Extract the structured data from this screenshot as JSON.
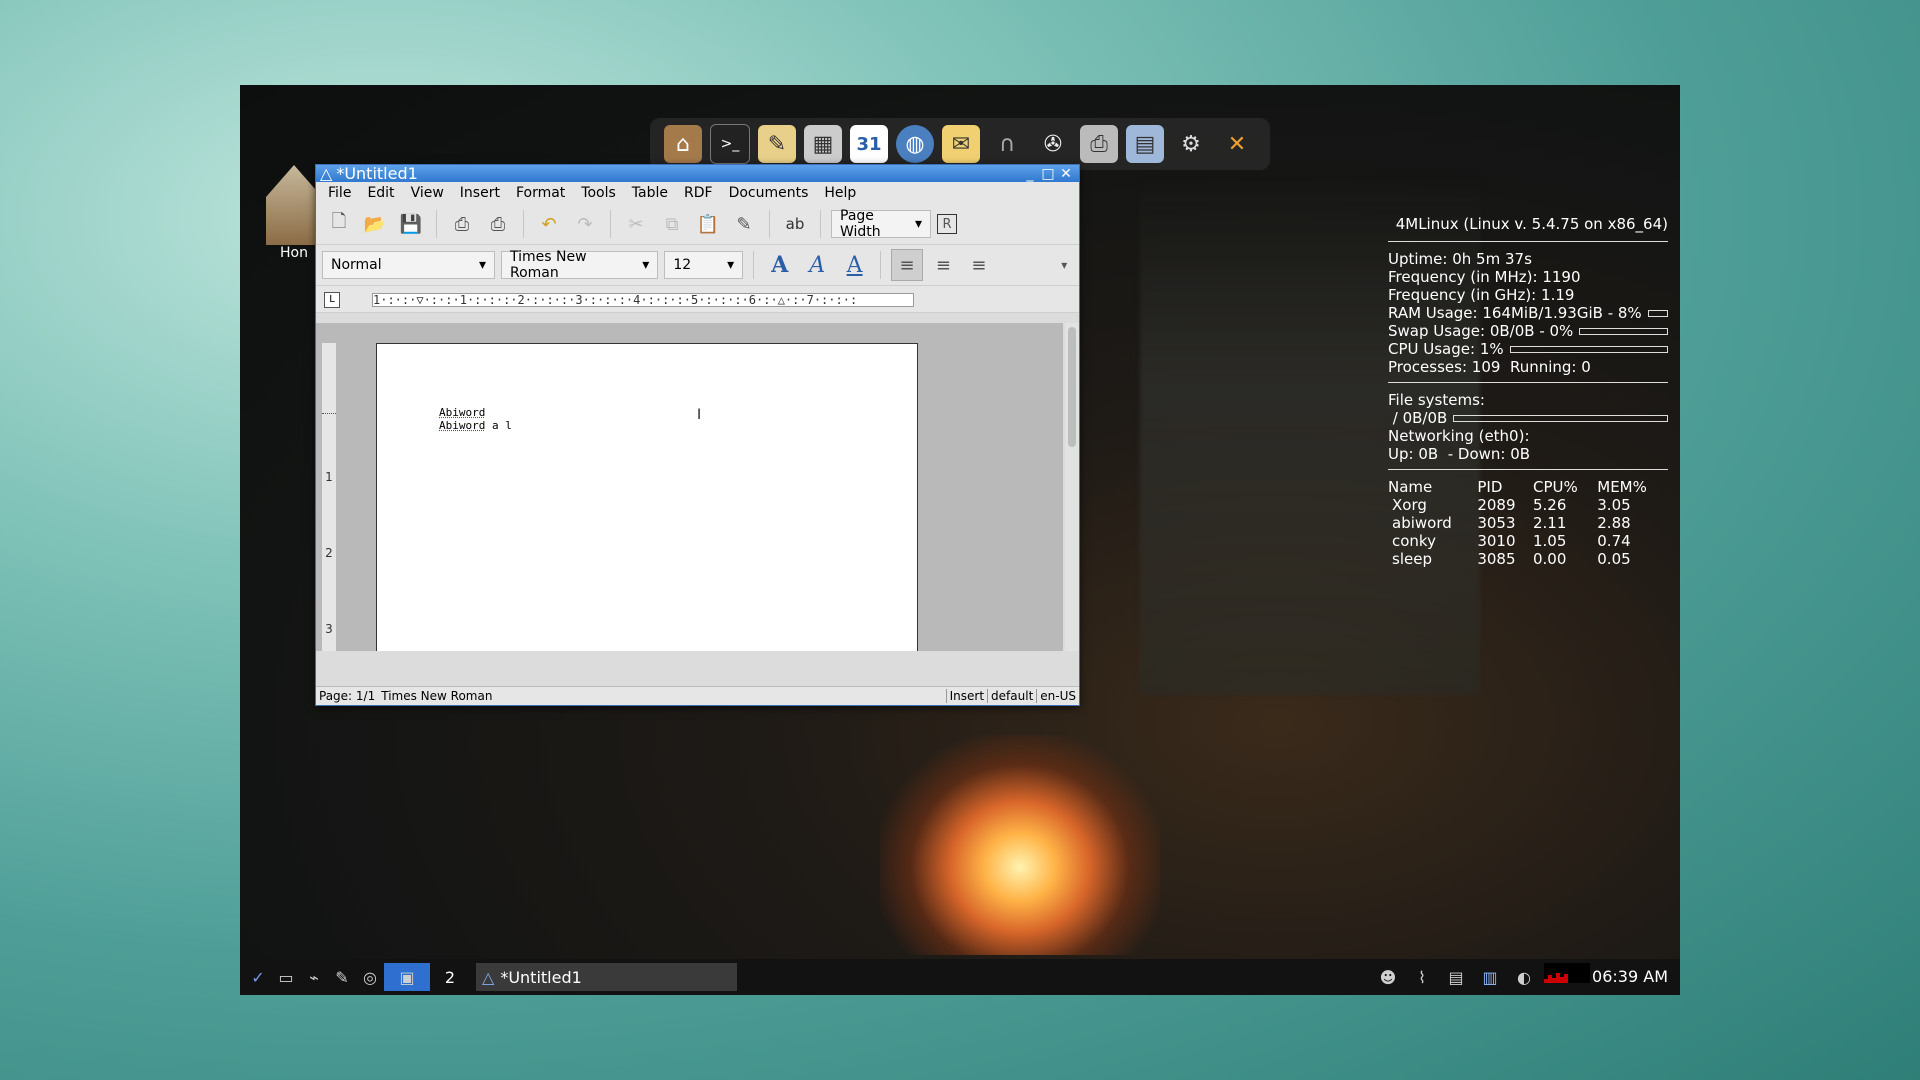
{
  "desktop": {
    "home_label": "Hon",
    "dock_icons": [
      "home-icon",
      "terminal-icon",
      "text-editor-icon",
      "calculator-icon",
      "calendar-icon",
      "browser-icon",
      "mail-icon",
      "headphones-icon",
      "media-icon",
      "printer-icon",
      "file-manager-icon",
      "settings-icon",
      "exit-icon"
    ],
    "calendar_day": "31"
  },
  "window": {
    "title": "*Untitled1",
    "menu": [
      "File",
      "Edit",
      "View",
      "Insert",
      "Format",
      "Tools",
      "Table",
      "RDF",
      "Documents",
      "Help"
    ],
    "zoom": "Page Width",
    "style": "Normal",
    "font": "Times New Roman",
    "size": "12",
    "ruler_numbers": [
      "1",
      "1",
      "2",
      "3",
      "4",
      "5",
      "6",
      "7"
    ],
    "vruler_numbers": [
      "1",
      "2",
      "3"
    ],
    "doc_lines": [
      {
        "word": "Abiword",
        "rest": ""
      },
      {
        "word": "Abiword",
        "rest": " a l"
      }
    ],
    "status": {
      "page": "Page: 1/1",
      "font": "Times New Roman",
      "mode": "Insert",
      "lang1": "default",
      "lang2": "en-US"
    }
  },
  "conky": {
    "header": "4MLinux (Linux v. 5.4.75 on x86_64)",
    "uptime_label": "Uptime:",
    "uptime": "0h 5m 37s",
    "freq_mhz_label": "Frequency (in MHz):",
    "freq_mhz": "1190",
    "freq_ghz_label": "Frequency (in GHz):",
    "freq_ghz": "1.19",
    "ram_label": "RAM Usage:",
    "ram": "164MiB/1.93GiB - 8%",
    "ram_fraction": 0.08,
    "swap_label": "Swap Usage:",
    "swap": "0B/0B - 0%",
    "swap_fraction": 0,
    "cpu_label": "CPU Usage:",
    "cpu": "1%",
    "cpu_fraction": 0.01,
    "proc_label": "Processes:",
    "processes": "109",
    "running_label": "Running:",
    "running": "0",
    "fs_label": "File systems:",
    "fs_root": "/ 0B/0B",
    "fs_fraction": 0,
    "net_label": "Networking (eth0):",
    "up_label": "Up:",
    "up": "0B",
    "down_label": "- Down:",
    "down": "0B",
    "proc_headers": [
      "Name",
      "PID",
      "CPU%",
      "MEM%"
    ],
    "procs": [
      [
        "Xorg",
        "2089",
        "5.26",
        "3.05"
      ],
      [
        "abiword",
        "3053",
        "2.11",
        "2.88"
      ],
      [
        "conky",
        "3010",
        "1.05",
        "0.74"
      ],
      [
        "sleep",
        "3085",
        "0.00",
        "0.05"
      ]
    ]
  },
  "taskbar": {
    "workspace": "2",
    "task_title": "*Untitled1",
    "clock": "06:39 AM"
  }
}
